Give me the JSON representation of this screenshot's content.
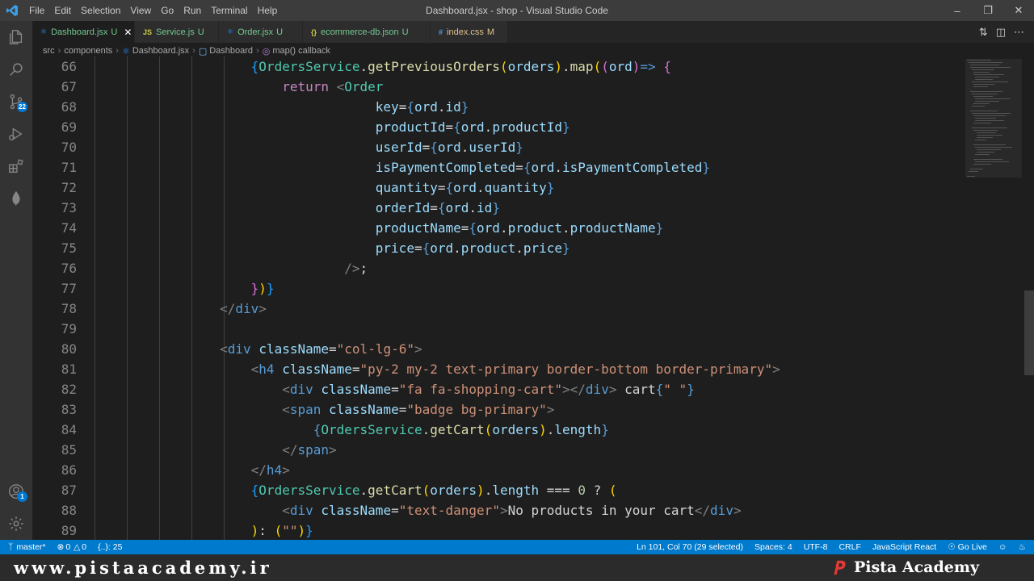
{
  "titlebar": {
    "menu": [
      "File",
      "Edit",
      "Selection",
      "View",
      "Go",
      "Run",
      "Terminal",
      "Help"
    ],
    "title": "Dashboard.jsx - shop - Visual Studio Code"
  },
  "activitybar": {
    "source_control_badge": "22",
    "accounts_badge": "1"
  },
  "tabs": [
    {
      "icon": "JSX",
      "name": "Dashboard.jsx",
      "flag": "U",
      "active": true
    },
    {
      "icon": "JS",
      "name": "Service.js",
      "flag": "U"
    },
    {
      "icon": "JSX",
      "name": "Order.jsx",
      "flag": "U"
    },
    {
      "icon": "{}",
      "name": "ecommerce-db.json",
      "flag": "U"
    },
    {
      "icon": "#",
      "name": "index.css",
      "flag": "M"
    }
  ],
  "breadcrumb": [
    "src",
    "components",
    "Dashboard.jsx",
    "Dashboard",
    "map() callback"
  ],
  "editor": {
    "line_numbers": [
      "66",
      "67",
      "68",
      "69",
      "70",
      "71",
      "72",
      "73",
      "74",
      "75",
      "76",
      "77",
      "78",
      "79",
      "80",
      "81",
      "82",
      "83",
      "84",
      "85",
      "86",
      "87",
      "88",
      "89"
    ]
  },
  "statusbar": {
    "branch": "master*",
    "errors": "0",
    "warnings": "0",
    "selector": "{..}: 25",
    "position": "Ln 101, Col 70 (29 selected)",
    "spaces": "Spaces: 4",
    "encoding": "UTF-8",
    "eol": "CRLF",
    "language": "JavaScript React",
    "golive": "Go Live"
  },
  "footer": {
    "site": "www.pistaacademy.ir",
    "brand": "Pista Academy"
  },
  "colors": {
    "accent": "#007acc",
    "keyword": "#c586c0",
    "component": "#4ec9b0",
    "attribute": "#9cdcfe",
    "string": "#ce9178",
    "function": "#dcdcaa"
  }
}
